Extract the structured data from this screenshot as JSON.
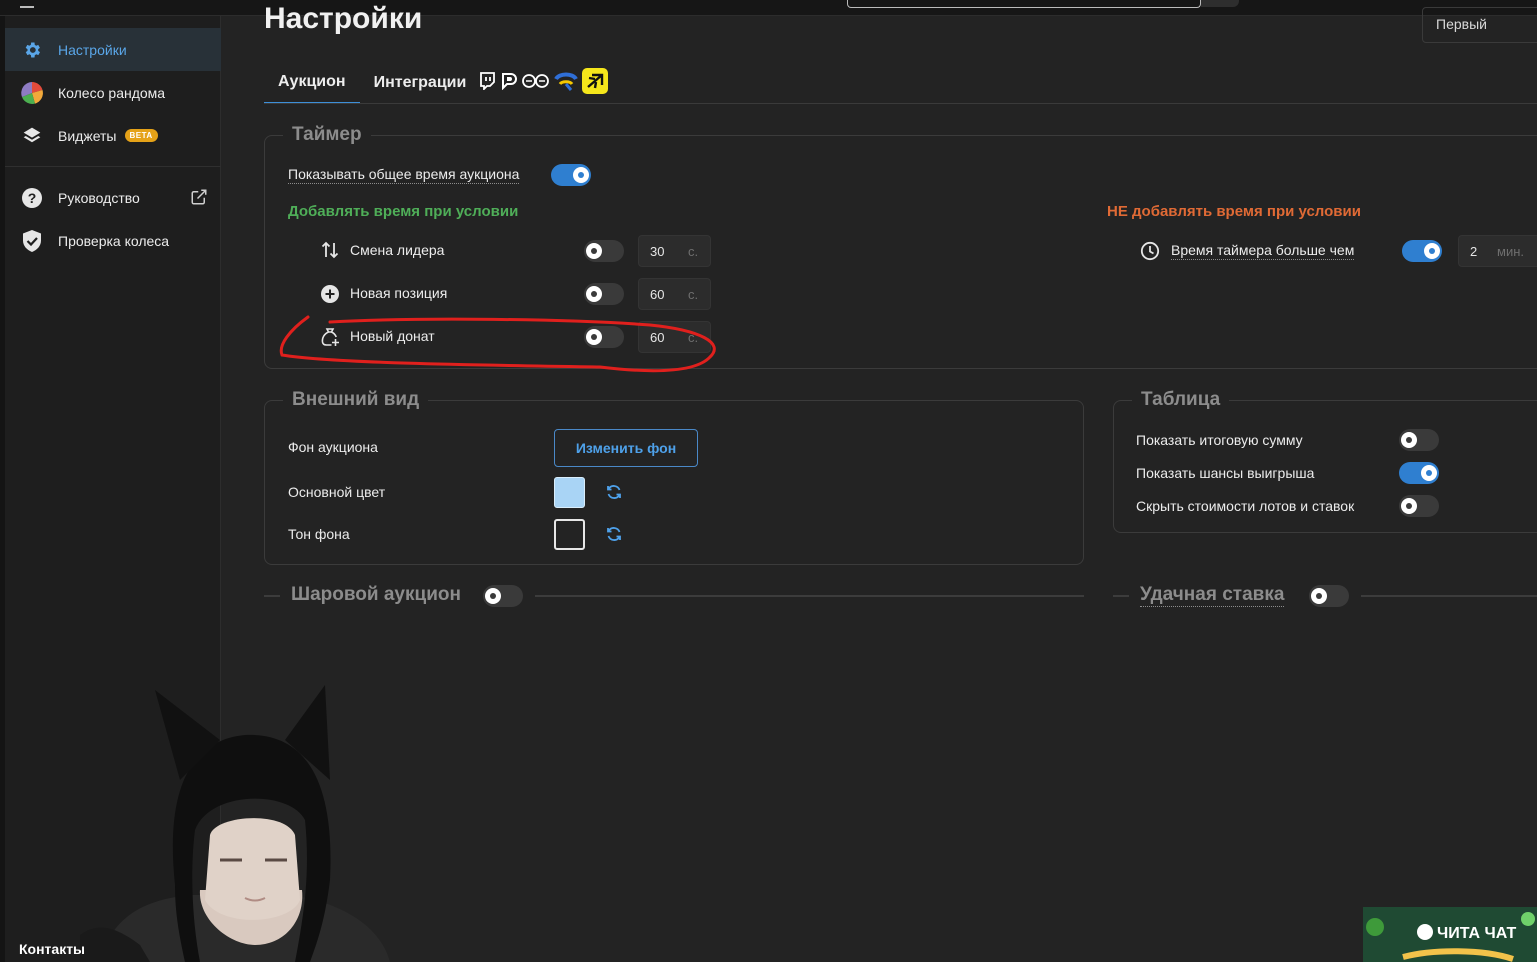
{
  "page": {
    "title": "Настройки",
    "preset_select": "Первый"
  },
  "sidebar": {
    "items": [
      {
        "label": "Настройки",
        "icon": "gear-icon",
        "active": true
      },
      {
        "label": "Колесо рандома",
        "icon": "pie-chart-icon"
      },
      {
        "label": "Виджеты",
        "icon": "layers-icon",
        "badge": "BETA"
      },
      {
        "label": "Руководство",
        "icon": "help-circle-icon",
        "external_icon": "external-link-icon"
      },
      {
        "label": "Проверка колеса",
        "icon": "shield-check-icon"
      }
    ]
  },
  "tabs": [
    {
      "label": "Аукцион",
      "active": true
    },
    {
      "label": "Интеграции"
    }
  ],
  "integration_icons": [
    "twitch-icon",
    "donationalerts-icon",
    "tribute-icon",
    "boosty-icon",
    "donatepay-icon"
  ],
  "timer": {
    "legend": "Таймер",
    "show_total": {
      "label": "Показывать общее время аукциона",
      "on": true
    },
    "add_heading": "Добавлять время при условии",
    "no_add_heading": "НЕ добавлять время при условии",
    "conditions": [
      {
        "label": "Смена лидера",
        "icon": "swap-vertical-icon",
        "on": false,
        "value": "30",
        "unit": "с."
      },
      {
        "label": "Новая позиция",
        "icon": "plus-circle-icon",
        "on": false,
        "value": "60",
        "unit": "с."
      },
      {
        "label": "Новый донат",
        "icon": "money-bag-icon",
        "on": false,
        "value": "60",
        "unit": "с."
      }
    ],
    "no_add_conditions": [
      {
        "label": "Время таймера больше чем",
        "icon": "clock-icon",
        "on": true,
        "value": "2",
        "unit": "мин."
      }
    ]
  },
  "appearance": {
    "legend": "Внешний вид",
    "background": {
      "label": "Фон аукциона",
      "button": "Изменить фон"
    },
    "primary_color": {
      "label": "Основной цвет",
      "color": "#a9d4f5"
    },
    "background_tone": {
      "label": "Тон фона",
      "color": "#232323"
    }
  },
  "table": {
    "legend": "Таблица",
    "options": [
      {
        "label": "Показать итоговую сумму",
        "on": false
      },
      {
        "label": "Показать шансы выигрыша",
        "on": true
      },
      {
        "label": "Скрыть стоимости лотов и ставок",
        "on": false
      }
    ]
  },
  "sections": {
    "ball_auction": {
      "label": "Шаровой аукцион",
      "on": false
    },
    "lucky_bid": {
      "label": "Удачная ставка",
      "on": false
    }
  },
  "stream": {
    "contact_label": "Контакты",
    "overlay_logo": "ЧИТА ЧАТ"
  },
  "colors": {
    "accent": "#2f7fd0",
    "green": "#4fae58",
    "orange": "#e06a35",
    "annotation": "#e0201d"
  }
}
